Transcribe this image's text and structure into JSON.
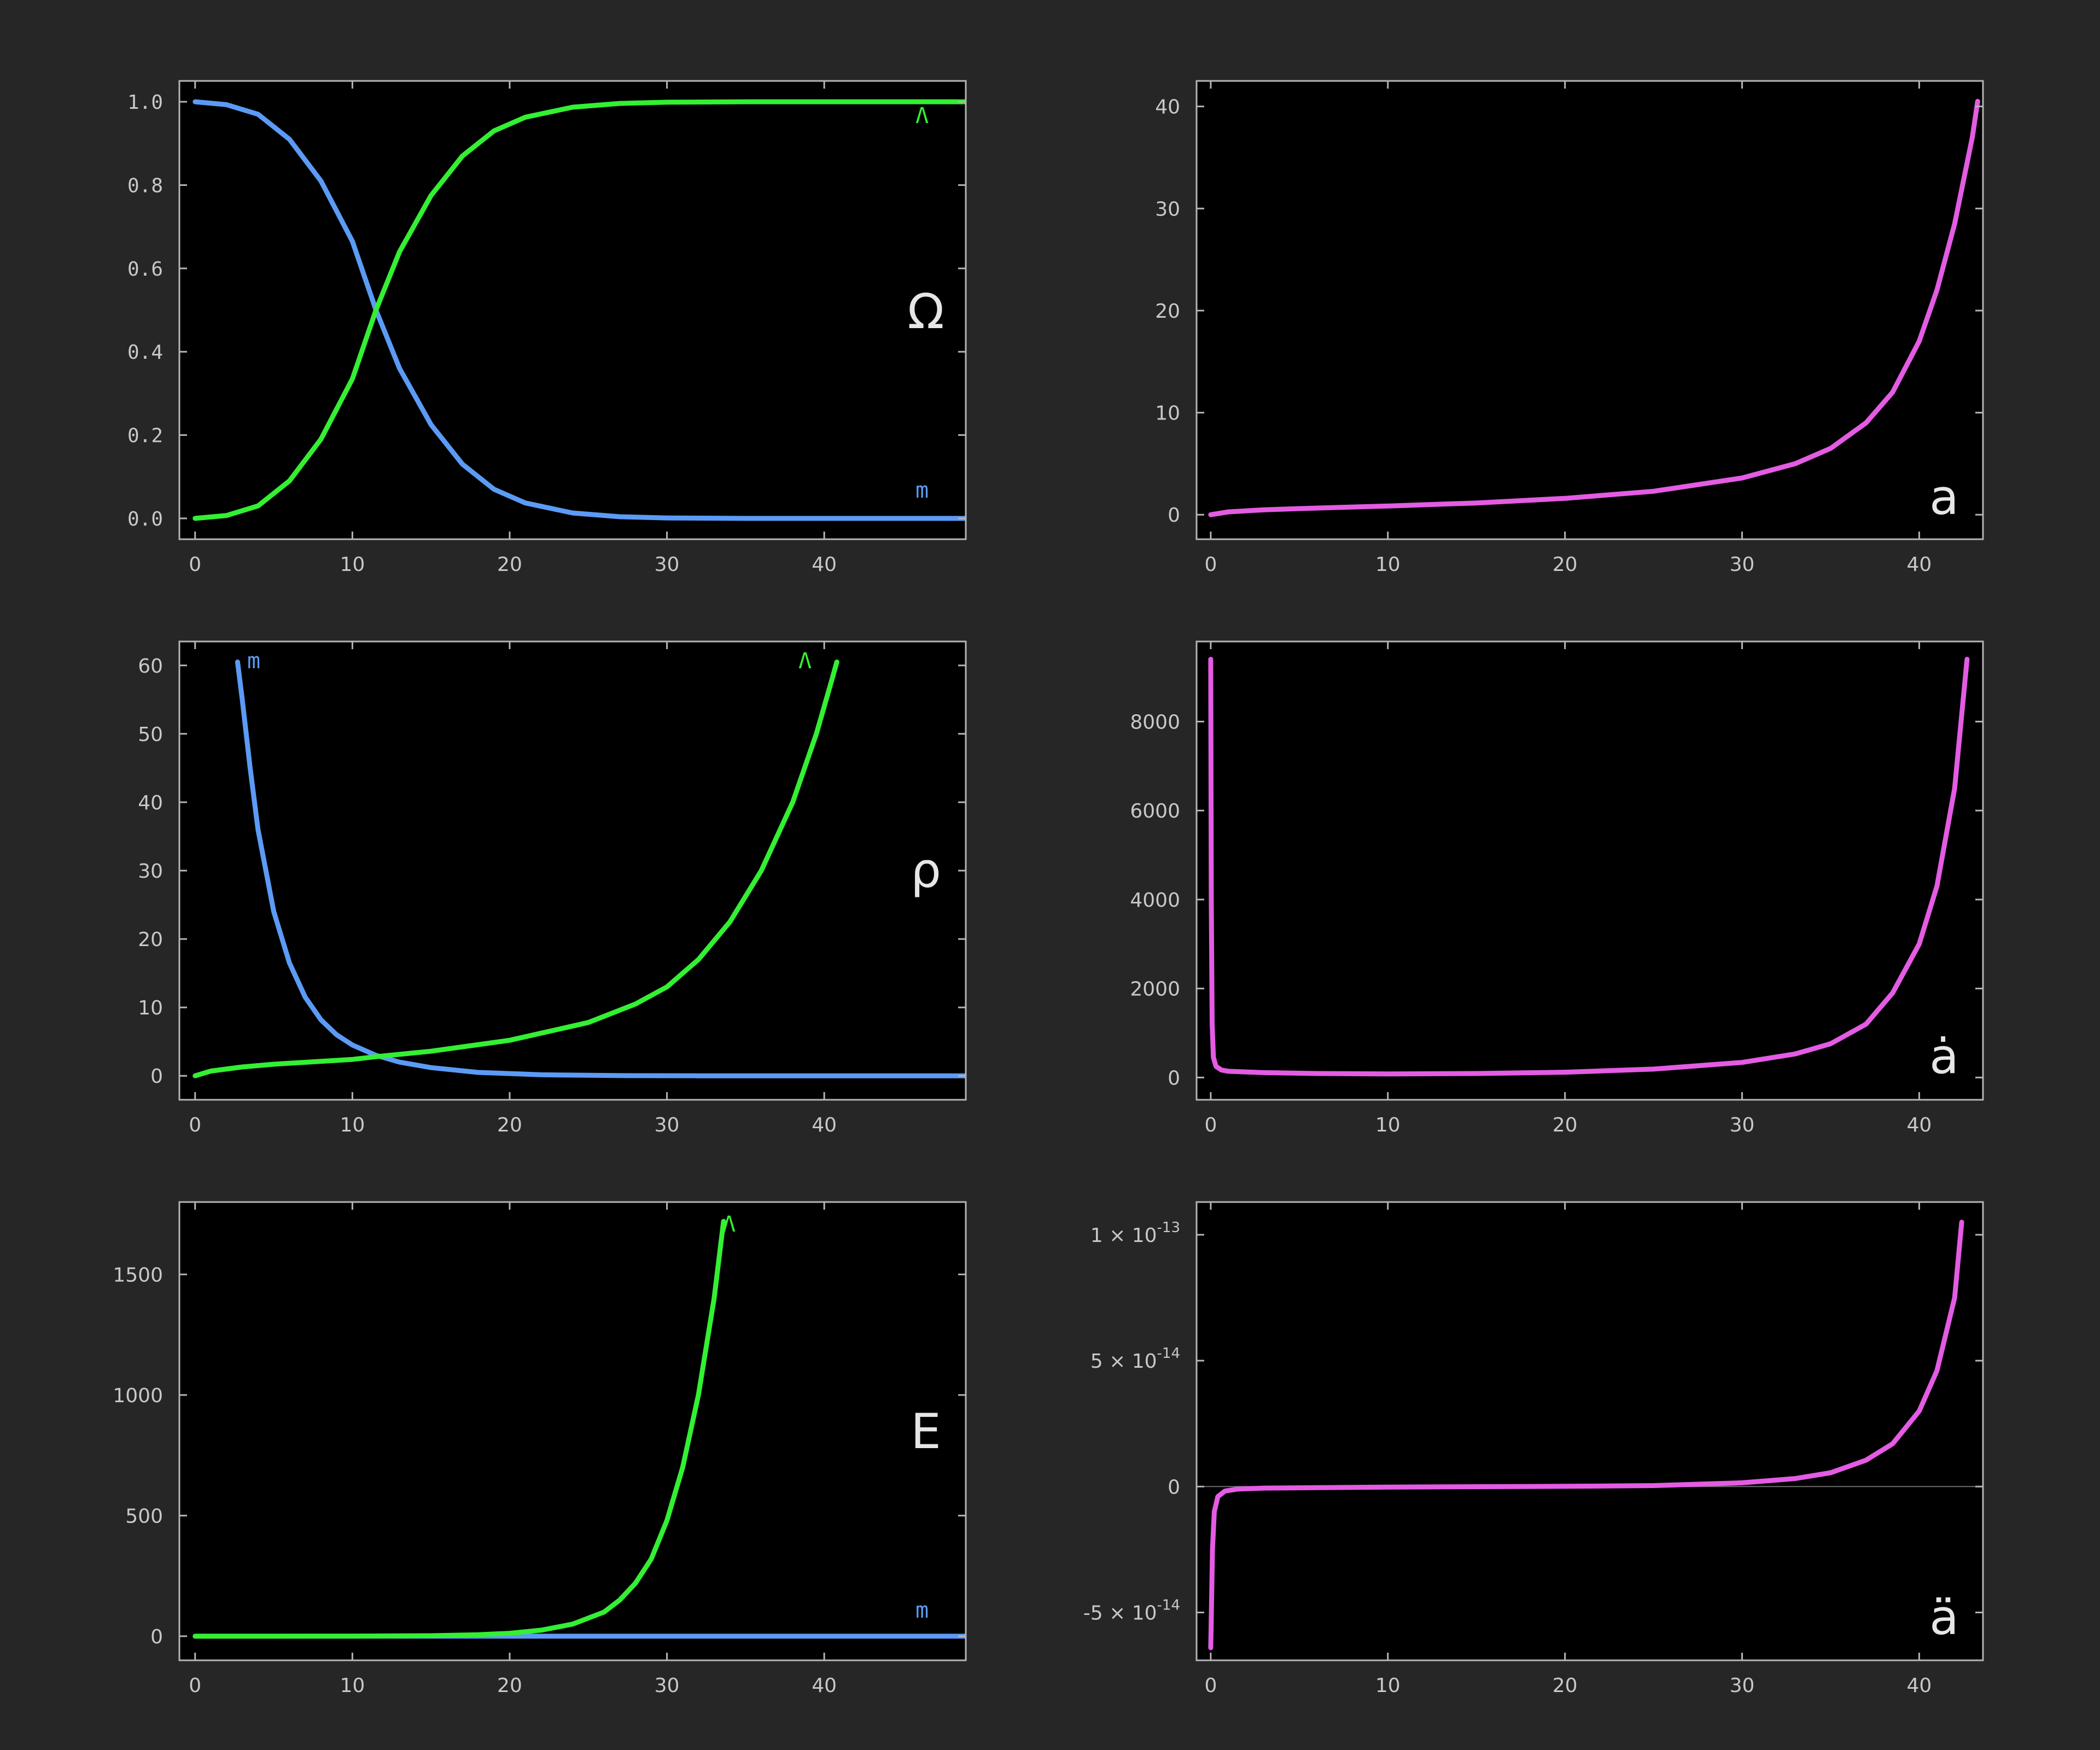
{
  "colors": {
    "background": "#262626",
    "plot_background": "#000000",
    "frame": "#b4b4b4",
    "tick_text": "#c8c8c8",
    "matter": "#5b9bf5",
    "lambda": "#33f033",
    "scale_factor": "#e35ce3",
    "zero_line": "#6a6a6a",
    "panel_label": "#e6e6e6"
  },
  "chart_data": [
    {
      "id": "omega",
      "type": "line",
      "panel_label": "Ω",
      "title": "",
      "xlabel": "",
      "ylabel": "",
      "xlim": [
        -1,
        49
      ],
      "ylim": [
        -0.05,
        1.05
      ],
      "xticks": [
        0,
        10,
        20,
        30,
        40
      ],
      "xtick_labels": [
        "0",
        "10",
        "20",
        "30",
        "40"
      ],
      "yticks": [
        0,
        0.2,
        0.4,
        0.6,
        0.8,
        1.0
      ],
      "ytick_labels": [
        "0.0",
        "0.2",
        "0.4",
        "0.6",
        "0.8",
        "1.0"
      ],
      "mono_ticks": true,
      "zero_line": false,
      "series": [
        {
          "name": "m",
          "color": "#5b9bf5",
          "points": [
            [
              0,
              1.0
            ],
            [
              2,
              0.993
            ],
            [
              4,
              0.97
            ],
            [
              6,
              0.91
            ],
            [
              8,
              0.81
            ],
            [
              10,
              0.665
            ],
            [
              11.5,
              0.5
            ],
            [
              13,
              0.36
            ],
            [
              15,
              0.225
            ],
            [
              17,
              0.13
            ],
            [
              19,
              0.07
            ],
            [
              21,
              0.037
            ],
            [
              24,
              0.013
            ],
            [
              27,
              0.004
            ],
            [
              30,
              0.001
            ],
            [
              35,
              0.0
            ],
            [
              49,
              0.0
            ]
          ]
        },
        {
          "name": "Λ",
          "color": "#33f033",
          "points": [
            [
              0,
              0.0
            ],
            [
              2,
              0.007
            ],
            [
              4,
              0.03
            ],
            [
              6,
              0.09
            ],
            [
              8,
              0.19
            ],
            [
              10,
              0.335
            ],
            [
              11.5,
              0.5
            ],
            [
              13,
              0.64
            ],
            [
              15,
              0.775
            ],
            [
              17,
              0.87
            ],
            [
              19,
              0.93
            ],
            [
              21,
              0.963
            ],
            [
              24,
              0.987
            ],
            [
              27,
              0.996
            ],
            [
              30,
              0.999
            ],
            [
              35,
              1.0
            ],
            [
              49,
              1.0
            ]
          ]
        }
      ]
    },
    {
      "id": "a",
      "type": "line",
      "panel_label": "a",
      "title": "",
      "xlabel": "",
      "ylabel": "",
      "xlim": [
        -0.8,
        43.6
      ],
      "ylim": [
        -2.4,
        42.5
      ],
      "xticks": [
        0,
        10,
        20,
        30,
        40
      ],
      "xtick_labels": [
        "0",
        "10",
        "20",
        "30",
        "40"
      ],
      "yticks": [
        0,
        10,
        20,
        30,
        40
      ],
      "ytick_labels": [
        "0",
        "10",
        "20",
        "30",
        "40"
      ],
      "mono_ticks": false,
      "zero_line": false,
      "series": [
        {
          "name": "",
          "color": "#e35ce3",
          "points": [
            [
              0,
              0.0
            ],
            [
              1,
              0.28
            ],
            [
              3,
              0.48
            ],
            [
              5,
              0.6
            ],
            [
              10,
              0.85
            ],
            [
              15,
              1.15
            ],
            [
              20,
              1.6
            ],
            [
              25,
              2.3
            ],
            [
              30,
              3.6
            ],
            [
              33,
              5.0
            ],
            [
              35,
              6.5
            ],
            [
              37,
              9.0
            ],
            [
              38.5,
              12.0
            ],
            [
              40,
              17.0
            ],
            [
              41,
              22.0
            ],
            [
              42,
              28.5
            ],
            [
              43,
              37.0
            ],
            [
              43.3,
              40.5
            ]
          ]
        }
      ]
    },
    {
      "id": "rho",
      "type": "line",
      "panel_label": "ρ",
      "title": "",
      "xlabel": "",
      "ylabel": "",
      "xlim": [
        -1,
        49
      ],
      "ylim": [
        -3.5,
        63.5
      ],
      "xticks": [
        0,
        10,
        20,
        30,
        40
      ],
      "xtick_labels": [
        "0",
        "10",
        "20",
        "30",
        "40"
      ],
      "yticks": [
        0,
        10,
        20,
        30,
        40,
        50,
        60
      ],
      "ytick_labels": [
        "0",
        "10",
        "20",
        "30",
        "40",
        "50",
        "60"
      ],
      "mono_ticks": false,
      "zero_line": false,
      "series": [
        {
          "name": "m",
          "color": "#5b9bf5",
          "points": [
            [
              2.7,
              60.5
            ],
            [
              3,
              55
            ],
            [
              3.5,
              45
            ],
            [
              4,
              36
            ],
            [
              5,
              24
            ],
            [
              6,
              16.5
            ],
            [
              7,
              11.5
            ],
            [
              8,
              8.2
            ],
            [
              9,
              6.0
            ],
            [
              10,
              4.5
            ],
            [
              11.5,
              3.0
            ],
            [
              13,
              2.0
            ],
            [
              15,
              1.2
            ],
            [
              18,
              0.5
            ],
            [
              22,
              0.15
            ],
            [
              27,
              0.03
            ],
            [
              32,
              0.0
            ],
            [
              49,
              0.0
            ]
          ]
        },
        {
          "name": "Λ",
          "color": "#33f033",
          "points": [
            [
              0,
              0.0
            ],
            [
              1,
              0.7
            ],
            [
              3,
              1.3
            ],
            [
              5,
              1.7
            ],
            [
              10,
              2.4
            ],
            [
              11.5,
              2.8
            ],
            [
              15,
              3.6
            ],
            [
              20,
              5.2
            ],
            [
              25,
              7.8
            ],
            [
              28,
              10.5
            ],
            [
              30,
              13.0
            ],
            [
              32,
              17.0
            ],
            [
              34,
              22.5
            ],
            [
              36,
              30.0
            ],
            [
              38,
              40.0
            ],
            [
              39.5,
              50.0
            ],
            [
              40.5,
              58.0
            ],
            [
              40.8,
              60.5
            ]
          ]
        }
      ]
    },
    {
      "id": "adot",
      "type": "line",
      "panel_label": "ȧ",
      "title": "",
      "xlabel": "",
      "ylabel": "",
      "xlim": [
        -0.8,
        43.6
      ],
      "ylim": [
        -500,
        9800
      ],
      "xticks": [
        0,
        10,
        20,
        30,
        40
      ],
      "xtick_labels": [
        "0",
        "10",
        "20",
        "30",
        "40"
      ],
      "yticks": [
        0,
        2000,
        4000,
        6000,
        8000
      ],
      "ytick_labels": [
        "0",
        "2000",
        "4000",
        "6000",
        "8000"
      ],
      "mono_ticks": false,
      "zero_line": false,
      "series": [
        {
          "name": "",
          "color": "#e35ce3",
          "points": [
            [
              0,
              9400
            ],
            [
              0.03,
              4000
            ],
            [
              0.08,
              1200
            ],
            [
              0.15,
              450
            ],
            [
              0.3,
              250
            ],
            [
              0.6,
              170
            ],
            [
              1,
              140
            ],
            [
              3,
              110
            ],
            [
              6,
              90
            ],
            [
              10,
              80
            ],
            [
              15,
              90
            ],
            [
              20,
              120
            ],
            [
              25,
              190
            ],
            [
              30,
              340
            ],
            [
              33,
              530
            ],
            [
              35,
              760
            ],
            [
              37,
              1200
            ],
            [
              38.5,
              1900
            ],
            [
              40,
              3000
            ],
            [
              41,
              4300
            ],
            [
              42,
              6500
            ],
            [
              42.7,
              9400
            ]
          ]
        }
      ]
    },
    {
      "id": "energy",
      "type": "line",
      "panel_label": "E",
      "title": "",
      "xlabel": "",
      "ylabel": "",
      "xlim": [
        -1,
        49
      ],
      "ylim": [
        -100,
        1800
      ],
      "xticks": [
        0,
        10,
        20,
        30,
        40
      ],
      "xtick_labels": [
        "0",
        "10",
        "20",
        "30",
        "40"
      ],
      "yticks": [
        0,
        500,
        1000,
        1500
      ],
      "ytick_labels": [
        "0",
        "500",
        "1000",
        "1500"
      ],
      "mono_ticks": false,
      "zero_line": false,
      "series": [
        {
          "name": "m",
          "color": "#5b9bf5",
          "points": [
            [
              0,
              0
            ],
            [
              49,
              0
            ]
          ]
        },
        {
          "name": "Λ",
          "color": "#33f033",
          "points": [
            [
              0,
              0
            ],
            [
              10,
              0.3
            ],
            [
              15,
              2
            ],
            [
              18,
              6
            ],
            [
              20,
              12
            ],
            [
              22,
              25
            ],
            [
              24,
              50
            ],
            [
              26,
              100
            ],
            [
              27,
              150
            ],
            [
              28,
              220
            ],
            [
              29,
              320
            ],
            [
              30,
              480
            ],
            [
              31,
              700
            ],
            [
              32,
              1000
            ],
            [
              33,
              1400
            ],
            [
              33.6,
              1720
            ]
          ]
        }
      ]
    },
    {
      "id": "addot",
      "type": "line",
      "panel_label": "ä",
      "title": "",
      "xlabel": "",
      "ylabel": "",
      "xlim": [
        -0.8,
        43.6
      ],
      "ylim": [
        -6.9e-14,
        1.13e-13
      ],
      "xticks": [
        0,
        10,
        20,
        30,
        40
      ],
      "xtick_labels": [
        "0",
        "10",
        "20",
        "30",
        "40"
      ],
      "yticks": [
        -5e-14,
        0,
        5e-14,
        1e-13
      ],
      "ytick_labels": [
        {
          "mantissa": "-5",
          "exp": "-14"
        },
        {
          "mantissa": "0",
          "exp": ""
        },
        {
          "mantissa": "5",
          "exp": "-14"
        },
        {
          "mantissa": "1",
          "exp": "-13"
        }
      ],
      "mono_ticks": false,
      "zero_line": true,
      "series": [
        {
          "name": "",
          "color": "#e35ce3",
          "points": [
            [
              0,
              -6.4e-14
            ],
            [
              0.05,
              -4.5e-14
            ],
            [
              0.1,
              -2.5e-14
            ],
            [
              0.2,
              -1e-14
            ],
            [
              0.4,
              -4e-15
            ],
            [
              0.8,
              -1.8e-15
            ],
            [
              1.5,
              -1e-15
            ],
            [
              3,
              -6e-16
            ],
            [
              10,
              -2e-16
            ],
            [
              20,
              1e-16
            ],
            [
              25,
              4e-16
            ],
            [
              30,
              1.5e-15
            ],
            [
              33,
              3.2e-15
            ],
            [
              35,
              5.5e-15
            ],
            [
              37,
              1.05e-14
            ],
            [
              38.5,
              1.7e-14
            ],
            [
              40,
              3e-14
            ],
            [
              41,
              4.6e-14
            ],
            [
              42,
              7.5e-14
            ],
            [
              42.4,
              1.05e-13
            ]
          ]
        }
      ]
    }
  ]
}
